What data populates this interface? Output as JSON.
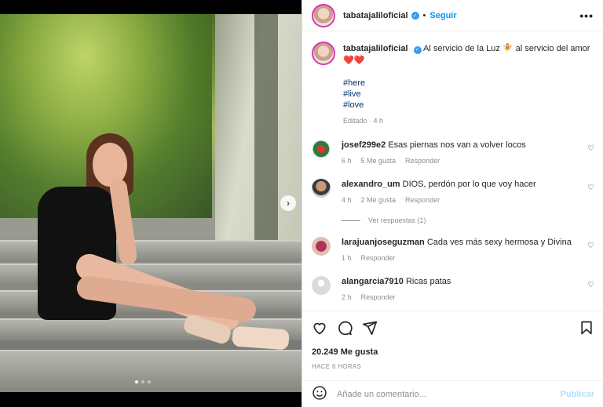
{
  "post": {
    "username": "tabatajalil oficial",
    "follow_label": "Seguir",
    "more_label": "•••",
    "separator": "•"
  },
  "caption": {
    "username": "tabatajaliloficial",
    "text": "Al servicio de la Luz 🧚 al servicio del amor",
    "hearts": "❤️❤️",
    "hashtags": [
      "#here",
      "#live",
      "#love"
    ],
    "edited": "Editado · 4 h"
  },
  "comments": [
    {
      "username": "josef299e2",
      "text": "Esas piernas nos van a volver locos",
      "time": "6 h",
      "likes": "5 Me gusta",
      "reply": "Responder"
    },
    {
      "username": "alexandro_um",
      "text": "DIOS, perdón por lo que voy hacer",
      "time": "4 h",
      "likes": "2 Me gusta",
      "reply": "Responder"
    },
    {
      "username": "larajuanjoseguzman",
      "text": "Cada ves más sexy hermosa y Divina",
      "time": "1 h",
      "likes": "",
      "reply": "Responder"
    },
    {
      "username": "alangarcia7910",
      "text": "Ricas patas",
      "time": "2 h",
      "likes": "",
      "reply": "Responder"
    }
  ],
  "view_replies": "Ver respuestas (1)",
  "likes_count": "20.249 Me gusta",
  "post_time": "HACE 6 HORAS",
  "comment_input": {
    "placeholder": "Añade un comentario..."
  },
  "publish_label": "Publicar",
  "carousel": {
    "total": 3,
    "active": 1
  },
  "icons": {
    "like": "heart-icon",
    "comment": "comment-icon",
    "share": "share-icon",
    "save": "bookmark-icon",
    "emoji": "emoji-icon",
    "next": "chevron-right-icon",
    "verified": "verified-badge-icon"
  },
  "colors": {
    "accent": "#0095f6",
    "publish_disabled": "#b2dffc",
    "meta": "#8e8e8e",
    "hashtag": "#00376b"
  }
}
